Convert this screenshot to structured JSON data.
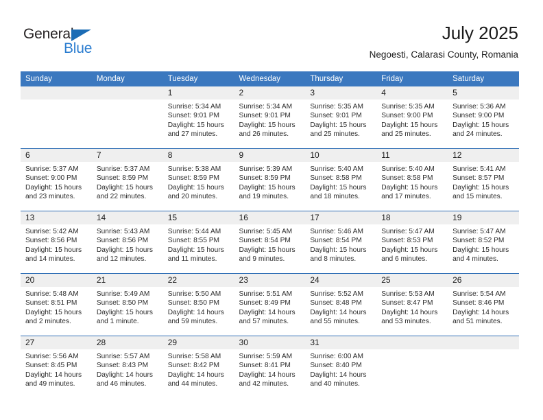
{
  "brand": {
    "name_part1": "General",
    "name_part2": "Blue",
    "accent_color": "#2b7dd0",
    "triangle_color": "#1b6cb5"
  },
  "header": {
    "title": "July 2025",
    "subtitle": "Negoesti, Calarasi County, Romania",
    "header_bg": "#3b78bf",
    "daynum_bg": "#efefef",
    "week_separator_color": "#2f6eb5"
  },
  "weekday_headers": [
    "Sunday",
    "Monday",
    "Tuesday",
    "Wednesday",
    "Thursday",
    "Friday",
    "Saturday"
  ],
  "labels": {
    "sunrise": "Sunrise:",
    "sunset": "Sunset:",
    "daylight": "Daylight:"
  },
  "weeks": [
    [
      {
        "day": "",
        "blank": true,
        "sunrise": "",
        "sunset": "",
        "daylight": ""
      },
      {
        "day": "",
        "blank": true,
        "sunrise": "",
        "sunset": "",
        "daylight": ""
      },
      {
        "day": "1",
        "sunrise": "Sunrise: 5:34 AM",
        "sunset": "Sunset: 9:01 PM",
        "daylight": "Daylight: 15 hours and 27 minutes."
      },
      {
        "day": "2",
        "sunrise": "Sunrise: 5:34 AM",
        "sunset": "Sunset: 9:01 PM",
        "daylight": "Daylight: 15 hours and 26 minutes."
      },
      {
        "day": "3",
        "sunrise": "Sunrise: 5:35 AM",
        "sunset": "Sunset: 9:01 PM",
        "daylight": "Daylight: 15 hours and 25 minutes."
      },
      {
        "day": "4",
        "sunrise": "Sunrise: 5:35 AM",
        "sunset": "Sunset: 9:00 PM",
        "daylight": "Daylight: 15 hours and 25 minutes."
      },
      {
        "day": "5",
        "sunrise": "Sunrise: 5:36 AM",
        "sunset": "Sunset: 9:00 PM",
        "daylight": "Daylight: 15 hours and 24 minutes."
      }
    ],
    [
      {
        "day": "6",
        "sunrise": "Sunrise: 5:37 AM",
        "sunset": "Sunset: 9:00 PM",
        "daylight": "Daylight: 15 hours and 23 minutes."
      },
      {
        "day": "7",
        "sunrise": "Sunrise: 5:37 AM",
        "sunset": "Sunset: 8:59 PM",
        "daylight": "Daylight: 15 hours and 22 minutes."
      },
      {
        "day": "8",
        "sunrise": "Sunrise: 5:38 AM",
        "sunset": "Sunset: 8:59 PM",
        "daylight": "Daylight: 15 hours and 20 minutes."
      },
      {
        "day": "9",
        "sunrise": "Sunrise: 5:39 AM",
        "sunset": "Sunset: 8:59 PM",
        "daylight": "Daylight: 15 hours and 19 minutes."
      },
      {
        "day": "10",
        "sunrise": "Sunrise: 5:40 AM",
        "sunset": "Sunset: 8:58 PM",
        "daylight": "Daylight: 15 hours and 18 minutes."
      },
      {
        "day": "11",
        "sunrise": "Sunrise: 5:40 AM",
        "sunset": "Sunset: 8:58 PM",
        "daylight": "Daylight: 15 hours and 17 minutes."
      },
      {
        "day": "12",
        "sunrise": "Sunrise: 5:41 AM",
        "sunset": "Sunset: 8:57 PM",
        "daylight": "Daylight: 15 hours and 15 minutes."
      }
    ],
    [
      {
        "day": "13",
        "sunrise": "Sunrise: 5:42 AM",
        "sunset": "Sunset: 8:56 PM",
        "daylight": "Daylight: 15 hours and 14 minutes."
      },
      {
        "day": "14",
        "sunrise": "Sunrise: 5:43 AM",
        "sunset": "Sunset: 8:56 PM",
        "daylight": "Daylight: 15 hours and 12 minutes."
      },
      {
        "day": "15",
        "sunrise": "Sunrise: 5:44 AM",
        "sunset": "Sunset: 8:55 PM",
        "daylight": "Daylight: 15 hours and 11 minutes."
      },
      {
        "day": "16",
        "sunrise": "Sunrise: 5:45 AM",
        "sunset": "Sunset: 8:54 PM",
        "daylight": "Daylight: 15 hours and 9 minutes."
      },
      {
        "day": "17",
        "sunrise": "Sunrise: 5:46 AM",
        "sunset": "Sunset: 8:54 PM",
        "daylight": "Daylight: 15 hours and 8 minutes."
      },
      {
        "day": "18",
        "sunrise": "Sunrise: 5:47 AM",
        "sunset": "Sunset: 8:53 PM",
        "daylight": "Daylight: 15 hours and 6 minutes."
      },
      {
        "day": "19",
        "sunrise": "Sunrise: 5:47 AM",
        "sunset": "Sunset: 8:52 PM",
        "daylight": "Daylight: 15 hours and 4 minutes."
      }
    ],
    [
      {
        "day": "20",
        "sunrise": "Sunrise: 5:48 AM",
        "sunset": "Sunset: 8:51 PM",
        "daylight": "Daylight: 15 hours and 2 minutes."
      },
      {
        "day": "21",
        "sunrise": "Sunrise: 5:49 AM",
        "sunset": "Sunset: 8:50 PM",
        "daylight": "Daylight: 15 hours and 1 minute."
      },
      {
        "day": "22",
        "sunrise": "Sunrise: 5:50 AM",
        "sunset": "Sunset: 8:50 PM",
        "daylight": "Daylight: 14 hours and 59 minutes."
      },
      {
        "day": "23",
        "sunrise": "Sunrise: 5:51 AM",
        "sunset": "Sunset: 8:49 PM",
        "daylight": "Daylight: 14 hours and 57 minutes."
      },
      {
        "day": "24",
        "sunrise": "Sunrise: 5:52 AM",
        "sunset": "Sunset: 8:48 PM",
        "daylight": "Daylight: 14 hours and 55 minutes."
      },
      {
        "day": "25",
        "sunrise": "Sunrise: 5:53 AM",
        "sunset": "Sunset: 8:47 PM",
        "daylight": "Daylight: 14 hours and 53 minutes."
      },
      {
        "day": "26",
        "sunrise": "Sunrise: 5:54 AM",
        "sunset": "Sunset: 8:46 PM",
        "daylight": "Daylight: 14 hours and 51 minutes."
      }
    ],
    [
      {
        "day": "27",
        "sunrise": "Sunrise: 5:56 AM",
        "sunset": "Sunset: 8:45 PM",
        "daylight": "Daylight: 14 hours and 49 minutes."
      },
      {
        "day": "28",
        "sunrise": "Sunrise: 5:57 AM",
        "sunset": "Sunset: 8:43 PM",
        "daylight": "Daylight: 14 hours and 46 minutes."
      },
      {
        "day": "29",
        "sunrise": "Sunrise: 5:58 AM",
        "sunset": "Sunset: 8:42 PM",
        "daylight": "Daylight: 14 hours and 44 minutes."
      },
      {
        "day": "30",
        "sunrise": "Sunrise: 5:59 AM",
        "sunset": "Sunset: 8:41 PM",
        "daylight": "Daylight: 14 hours and 42 minutes."
      },
      {
        "day": "31",
        "sunrise": "Sunrise: 6:00 AM",
        "sunset": "Sunset: 8:40 PM",
        "daylight": "Daylight: 14 hours and 40 minutes."
      },
      {
        "day": "",
        "blank": true,
        "sunrise": "",
        "sunset": "",
        "daylight": ""
      },
      {
        "day": "",
        "blank": true,
        "sunrise": "",
        "sunset": "",
        "daylight": ""
      }
    ]
  ]
}
